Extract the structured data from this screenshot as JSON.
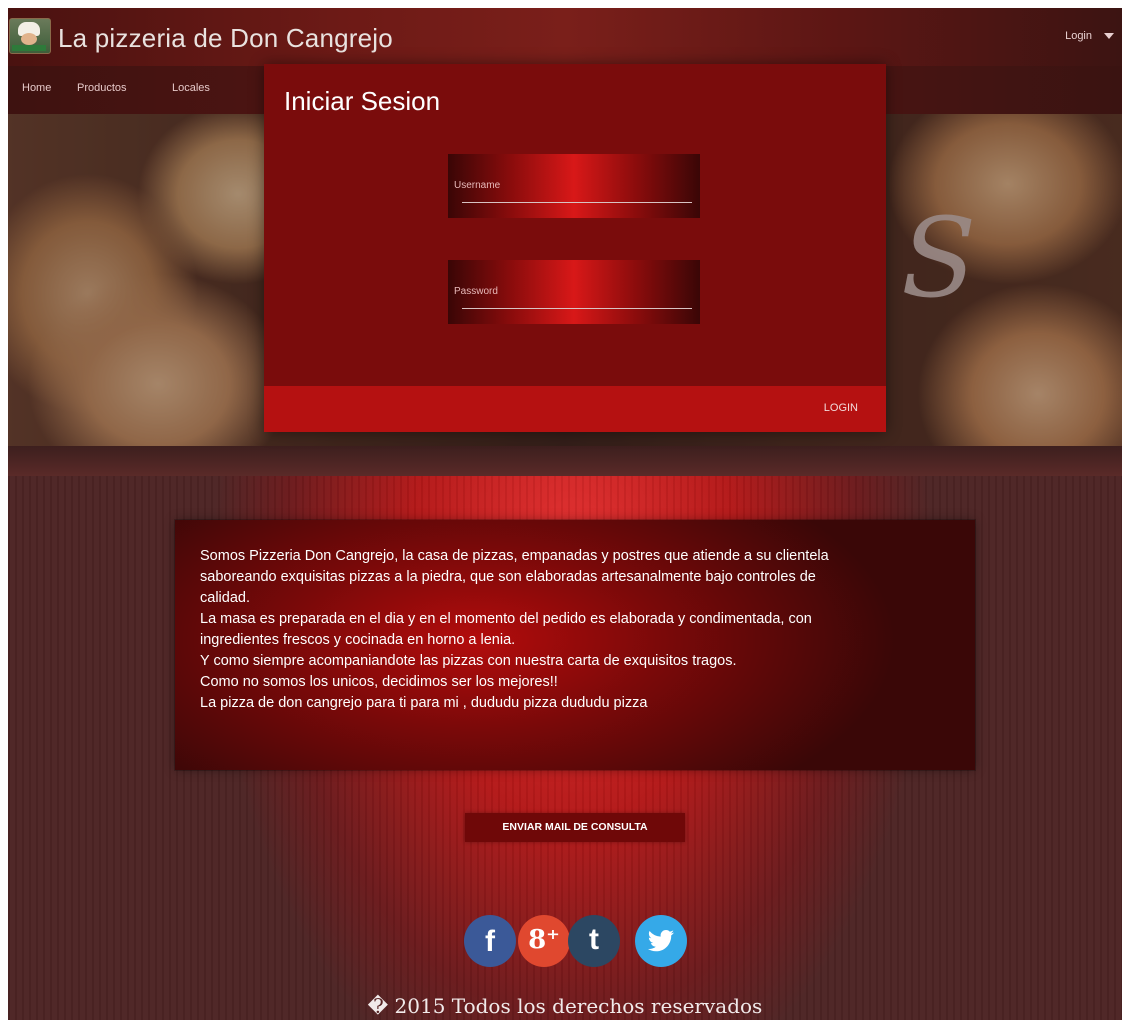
{
  "header": {
    "title": "La pizzeria de Don Cangrejo",
    "login_menu": "Login"
  },
  "nav": {
    "items": [
      "Home",
      "Productos",
      "Locales"
    ]
  },
  "modal": {
    "title": "Iniciar Sesion",
    "username_label": "Username",
    "password_label": "Password",
    "username_value": "",
    "password_value": "",
    "login_button": "LOGIN"
  },
  "about": {
    "lines": [
      "Somos Pizzeria Don Cangrejo, la casa de pizzas, empanadas y postres que atiende a su clientela",
      "saboreando exquisitas pizzas a la piedra, que son elaboradas artesanalmente bajo controles de",
      "calidad.",
      "La masa es preparada en el dia y en el momento del pedido es elaborada y condimentada, con",
      "ingredientes frescos y cocinada en horno a lenia.",
      "Y como siempre acompaniandote las pizzas con nuestra carta de exquisitos tragos.",
      "Como no somos los unicos, decidimos ser los mejores!!",
      "La pizza de don cangrejo para ti para mi , dududu pizza dududu pizza"
    ]
  },
  "contact_button": "ENVIAR MAIL DE CONSULTA",
  "social": {
    "facebook": "f",
    "googleplus": "8⁺",
    "tumblr": "t",
    "icons": [
      "facebook-icon",
      "googleplus-icon",
      "tumblr-icon",
      "twitter-icon"
    ]
  },
  "footer": "� 2015 Todos los derechos reservados",
  "colors": {
    "accent": "#b51111",
    "modal_bg": "#7a0c0c",
    "header_bg": "#6d1a16"
  }
}
